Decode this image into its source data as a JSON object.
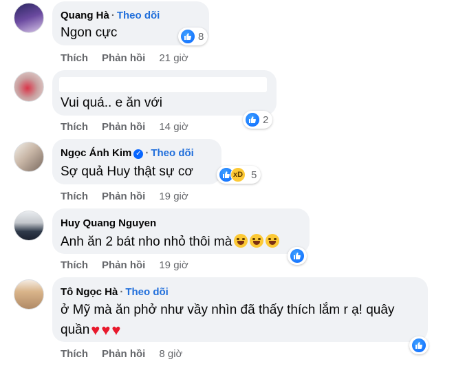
{
  "actions": {
    "like": "Thích",
    "reply": "Phản hồi"
  },
  "comments": [
    {
      "author": "Quang Hà",
      "follow": "Theo dõi",
      "text": "Ngon cực",
      "time": "21 giờ",
      "reaction_count": "8"
    },
    {
      "author": "",
      "follow": "",
      "text": "Vui quá.. e ăn với",
      "time": "14 giờ",
      "reaction_count": "2"
    },
    {
      "author": "Ngọc Ánh Kim",
      "follow": "Theo dõi",
      "text": "Sợ quả Huy thật sự cơ",
      "time": "19 giờ",
      "reaction_count": "5",
      "verified": true
    },
    {
      "author": "Huy Quang Nguyen",
      "follow": "",
      "text": "Anh ăn 2 bát nho nhỏ thôi mà",
      "time": "19 giờ",
      "reaction_count": ""
    },
    {
      "author": "Tô Ngọc Hà",
      "follow": "Theo dõi",
      "text_line1": "ở Mỹ mà ăn phở như vầy nhìn đã thấy thích lắm r ạ! quây",
      "text_line2": "quần",
      "time": "8 giờ",
      "reaction_count": ""
    }
  ],
  "icons": {
    "like": "like-icon",
    "haha": "haha-icon",
    "emoji": "grinning-tongue-emoji",
    "heart": "red-heart-emoji",
    "verified": "verified-badge-icon"
  },
  "colors": {
    "bubble": "#f0f2f5",
    "follow": "#216fdb",
    "like": "#0866ff",
    "heart": "#e8192c"
  }
}
